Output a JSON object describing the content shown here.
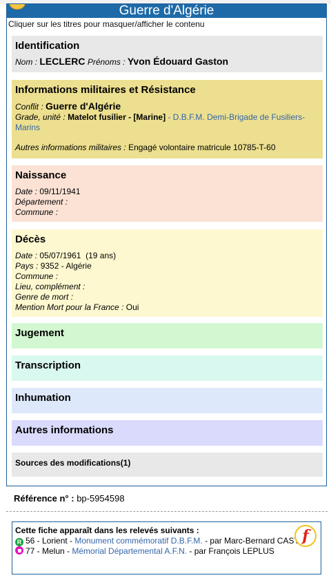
{
  "header": {
    "title": "Guerre d'Algérie",
    "hint": "Cliquer sur les titres pour masquer/afficher le contenu"
  },
  "identification": {
    "title": "Identification",
    "nom_label": "Nom :",
    "nom": "LECLERC",
    "prenoms_label": "Prénoms :",
    "prenoms": "Yvon Édouard Gaston"
  },
  "militaire": {
    "title": "Informations militaires et Résistance",
    "conflit_label": "Conflit :",
    "conflit": "Guerre d'Algérie",
    "grade_label": "Grade, unité :",
    "grade": "Matelot fusilier - [Marine]",
    "sep": " - ",
    "unite_link": "D.B.F.M. Demi-Brigade de Fusiliers-Marins",
    "autres_label": "Autres informations militaires :",
    "autres": "Engagé volontaire matricule 10785-T-60"
  },
  "naissance": {
    "title": "Naissance",
    "date_label": "Date :",
    "date": "09/11/1941",
    "dept_label": "Département :",
    "commune_label": "Commune :"
  },
  "deces": {
    "title": "Décès",
    "date_label": "Date :",
    "date": "05/07/1961  (19 ans)",
    "pays_label": "Pays :",
    "pays": "9352 - Algérie",
    "commune_label": "Commune :",
    "lieu_label": "Lieu, complément :",
    "genre_label": "Genre de mort :",
    "mention_label": "Mention Mort pour la France :",
    "mention": "Oui"
  },
  "sections": {
    "jugement": "Jugement",
    "transcription": "Transcription",
    "inhumation": "Inhumation",
    "autres": "Autres informations",
    "sources": "Sources des modifications(1)"
  },
  "reference": {
    "label": "Référence n° :",
    "value": "bp-5954598"
  },
  "releves": {
    "head": "Cette fiche apparaît dans les relevés suivants :",
    "f_icon_letter": "f",
    "items": [
      {
        "icon": "R",
        "prefix": "56 - Lorient - ",
        "link": "Monument commémoratif D.B.F.M.",
        "suffix": " - par Marc-Bernard CASTEL"
      },
      {
        "icon": "",
        "prefix": "77 - Melun - ",
        "link": "Mémorial Départemental A.F.N.",
        "suffix": " - par François LEPLUS"
      }
    ]
  },
  "colors": {
    "header_blue": "#1e6aa8",
    "link_blue": "#3366aa",
    "identification_bg": "#e8e8e8",
    "militaire_bg": "#ecdf8f",
    "naissance_bg": "#fbe2d5",
    "deces_bg": "#fdf8cf",
    "jugement_bg": "#d3f7d0",
    "transcription_bg": "#d9f8ef",
    "inhumation_bg": "#dde9fb",
    "autres_bg": "#dadafc"
  }
}
